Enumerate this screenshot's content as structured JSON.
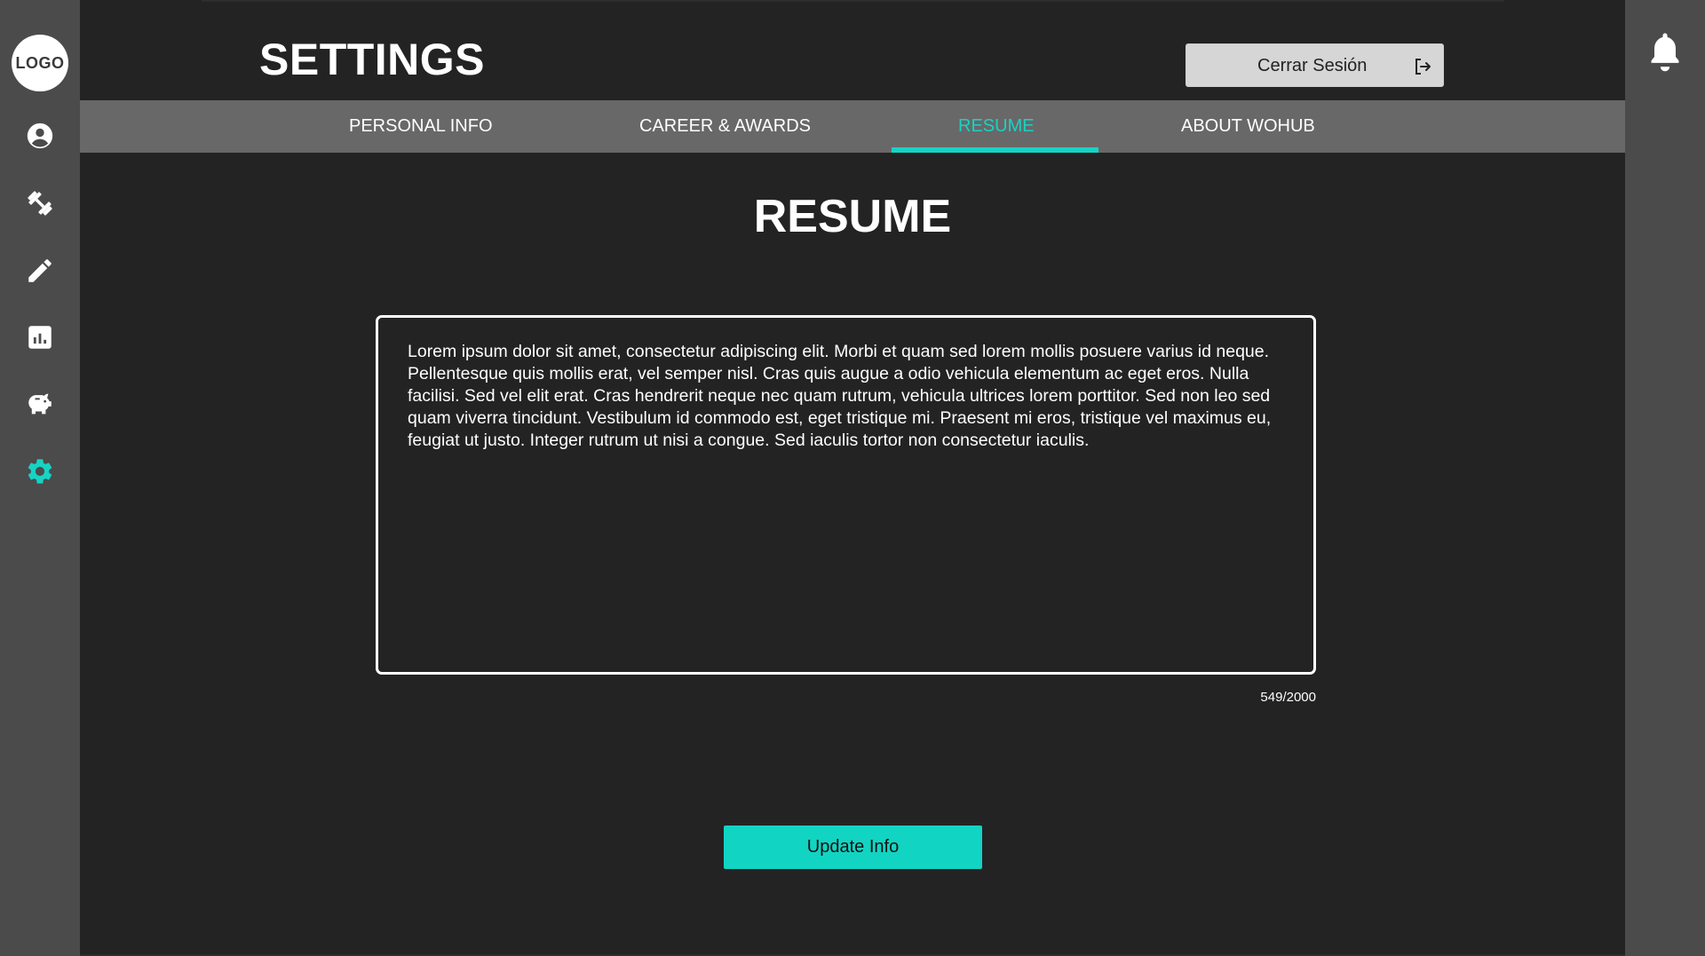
{
  "sidebar": {
    "logo_text": "LOGO",
    "items": [
      {
        "icon": "user-circle-icon",
        "active": false
      },
      {
        "icon": "dumbbell-icon",
        "active": false
      },
      {
        "icon": "pencil-icon",
        "active": false
      },
      {
        "icon": "bar-chart-icon",
        "active": false
      },
      {
        "icon": "piggy-bank-icon",
        "active": false
      },
      {
        "icon": "gear-icon",
        "active": true
      }
    ]
  },
  "header": {
    "title": "SETTINGS",
    "logout_label": "Cerrar Sesión"
  },
  "tabs": [
    {
      "label": "PERSONAL INFO",
      "active": false
    },
    {
      "label": "CAREER & AWARDS",
      "active": false
    },
    {
      "label": "RESUME",
      "active": true
    },
    {
      "label": "ABOUT WOHUB",
      "active": false
    }
  ],
  "resume": {
    "title": "RESUME",
    "text": "Lorem ipsum dolor sit amet, consectetur adipiscing elit. Morbi et quam sed lorem mollis posuere varius id neque. Pellentesque quis mollis erat, vel semper nisl. Cras quis augue a odio vehicula elementum ac eget eros. Nulla facilisi. Sed vel elit erat. Cras hendrerit neque nec quam rutrum, vehicula ultrices lorem porttitor. Sed non leo sed quam viverra tincidunt. Vestibulum id commodo est, eget tristique mi. Praesent mi eros, tristique vel maximus eu, feugiat ut justo. Integer rutrum ut nisi a congue. Sed iaculis tortor non consectetur iaculis.",
    "char_count": "549/2000",
    "update_label": "Update Info"
  },
  "colors": {
    "accent": "#17d3c4",
    "sidebar_bg": "#4b4b4b",
    "main_bg": "#232323",
    "tabbar_bg": "#686868"
  }
}
